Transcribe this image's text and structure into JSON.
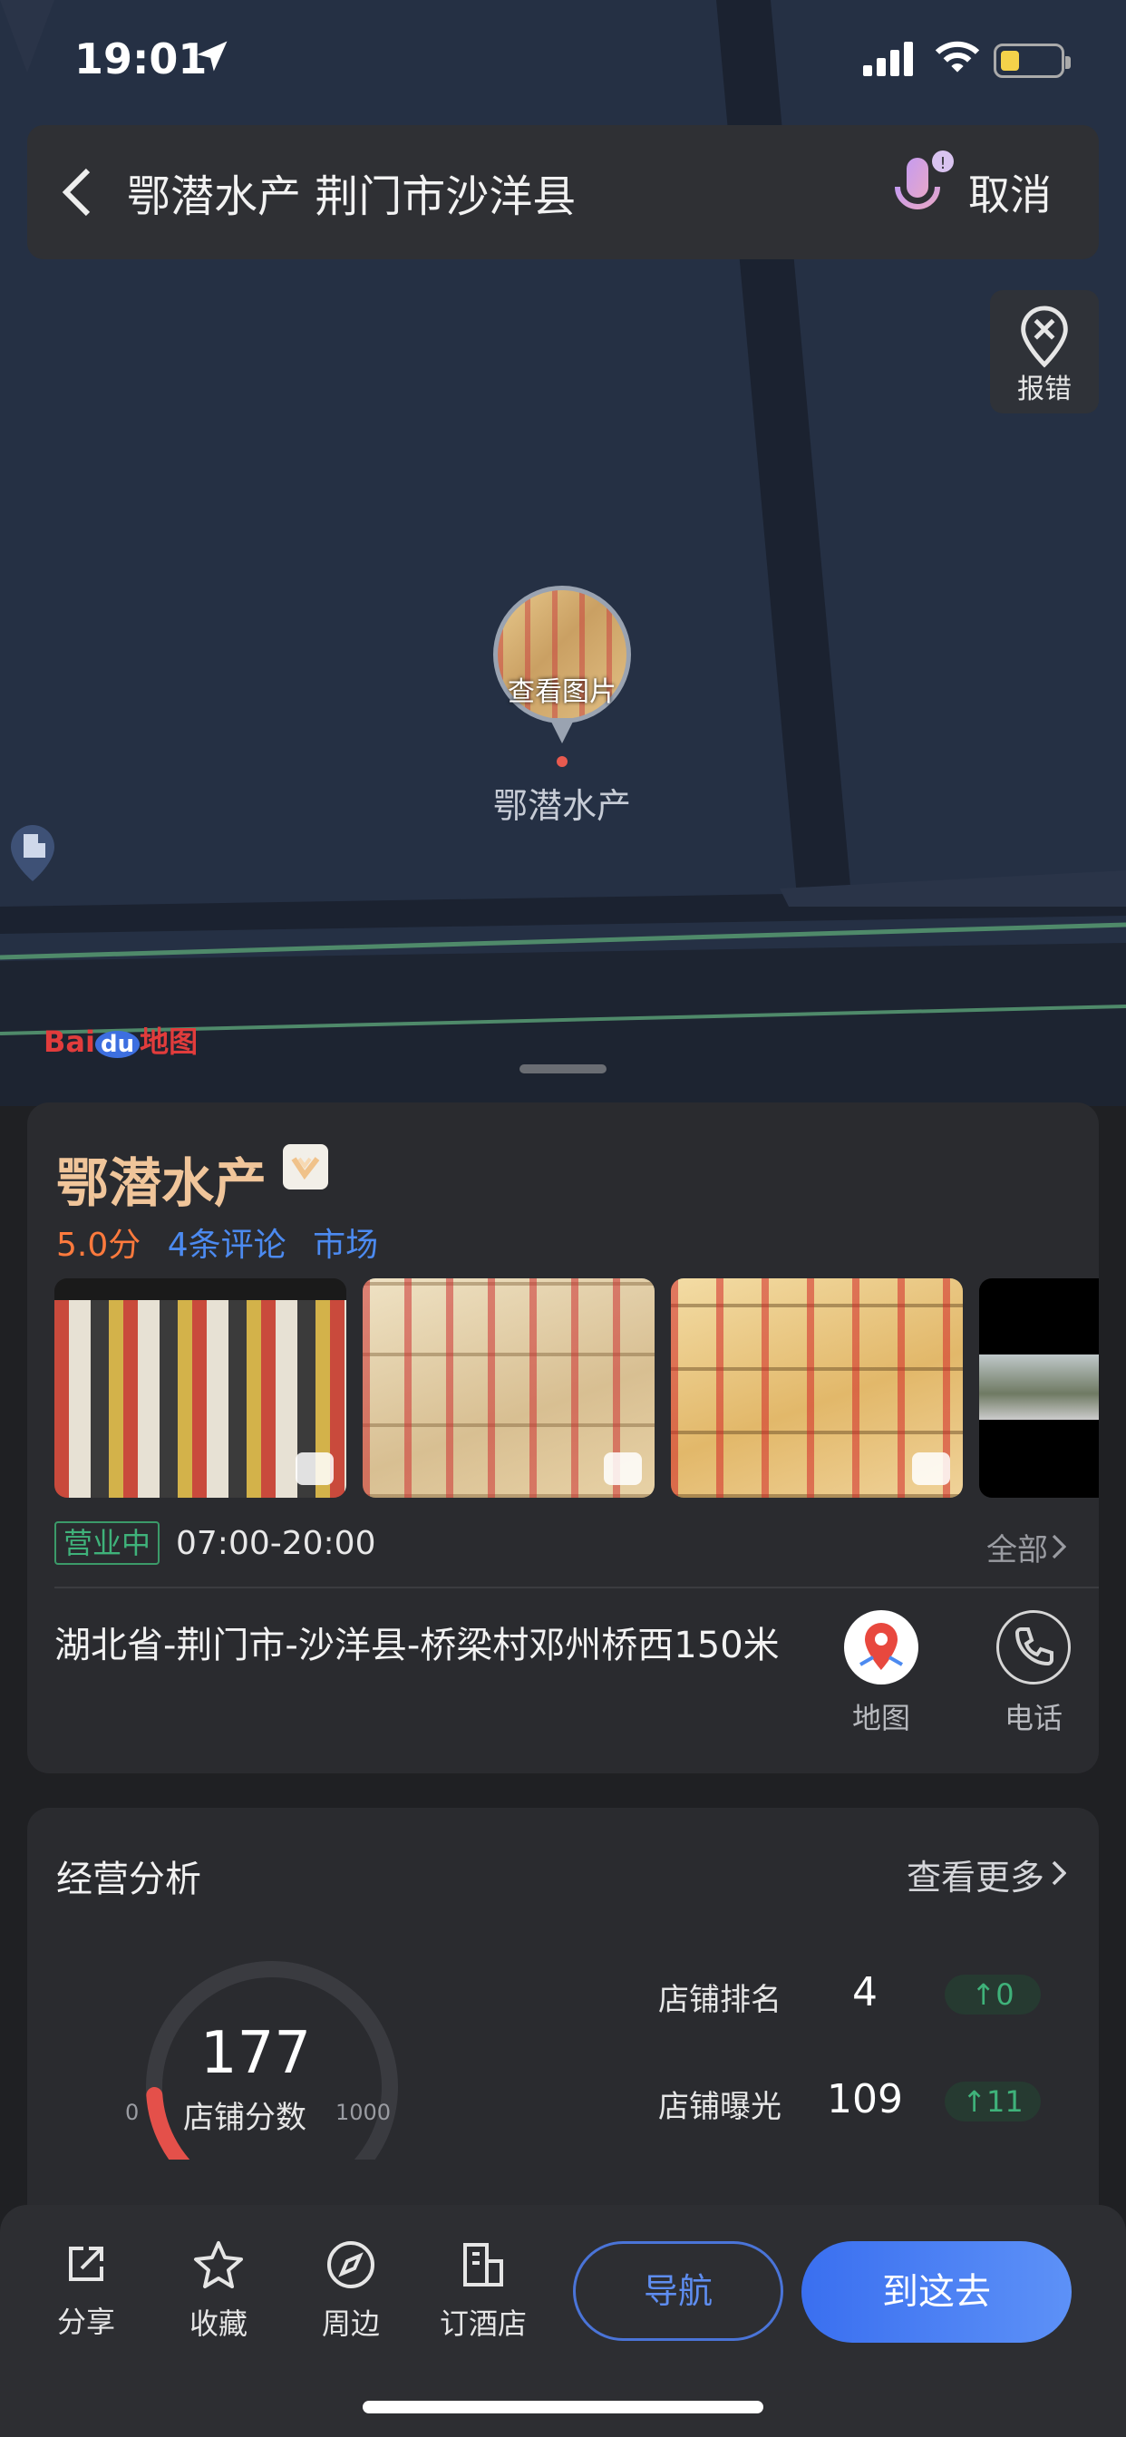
{
  "status_bar": {
    "time": "19:01"
  },
  "search": {
    "query": "鄂潜水产 荆门市沙洋县",
    "cancel_label": "取消"
  },
  "map": {
    "report_label": "报错",
    "pin_photo_label": "查看图片",
    "poi_name": "鄂潜水产",
    "logo_text_1": "Bai",
    "logo_text_2": "du",
    "logo_text_3": "地图"
  },
  "store": {
    "name": "鄂潜水产",
    "score": "5.0分",
    "reviews": "4条评论",
    "category": "市场",
    "open_status": "营业中",
    "hours": "07:00-20:00",
    "all_label": "全部",
    "address": "湖北省-荆门市-沙洋县-桥梁村邓州桥西150米",
    "map_label": "地图",
    "phone_label": "电话"
  },
  "business": {
    "title": "经营分析",
    "more_label": "查看更多",
    "score_value": "177",
    "score_label": "店铺分数",
    "gauge_min": "0",
    "gauge_max": "1000",
    "gauge_fraction": 0.177,
    "rank_label": "店铺排名",
    "rank_value": "4",
    "rank_change": "0",
    "exposure_label": "店铺曝光",
    "exposure_value": "109",
    "exposure_change": "11"
  },
  "bottom_bar": {
    "share_label": "分享",
    "favorite_label": "收藏",
    "nearby_label": "周边",
    "hotel_label": "订酒店",
    "navigate_label": "导航",
    "go_label": "到这去"
  },
  "colors": {
    "accent_blue": "#4c8af0",
    "store_name": "#f0c59a",
    "score_orange": "#ff7a3d",
    "open_green": "#3fb27a",
    "gauge_red": "#e4504a"
  }
}
